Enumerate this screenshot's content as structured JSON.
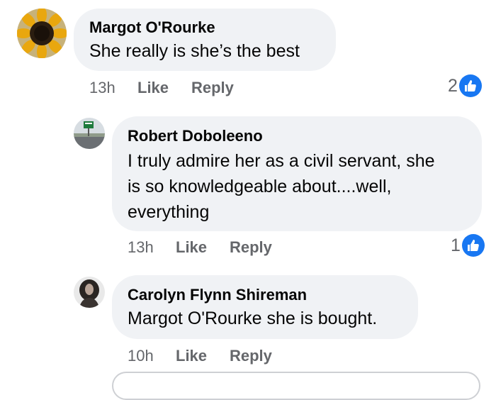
{
  "comments": [
    {
      "author": "Margot O'Rourke",
      "text": "She really is she’s the best",
      "time": "13h",
      "like_label": "Like",
      "reply_label": "Reply",
      "reaction_count": "2",
      "avatar_icon": "sunflower-avatar"
    },
    {
      "author": "Robert Doboleeno",
      "text_lines": [
        "I truly admire her as a civil servant, she",
        "is so knowledgeable about....well,",
        "everything"
      ],
      "time": "13h",
      "like_label": "Like",
      "reply_label": "Reply",
      "reaction_count": "1",
      "avatar_icon": "highway-sign-avatar"
    },
    {
      "author": "Carolyn Flynn Shireman",
      "text": "Margot O'Rourke she is bought.",
      "time": "10h",
      "like_label": "Like",
      "reply_label": "Reply",
      "avatar_icon": "portrait-avatar"
    }
  ],
  "colors": {
    "bubble_background": "#f0f2f5",
    "like_blue": "#1877f2",
    "secondary_text": "#65676b"
  }
}
